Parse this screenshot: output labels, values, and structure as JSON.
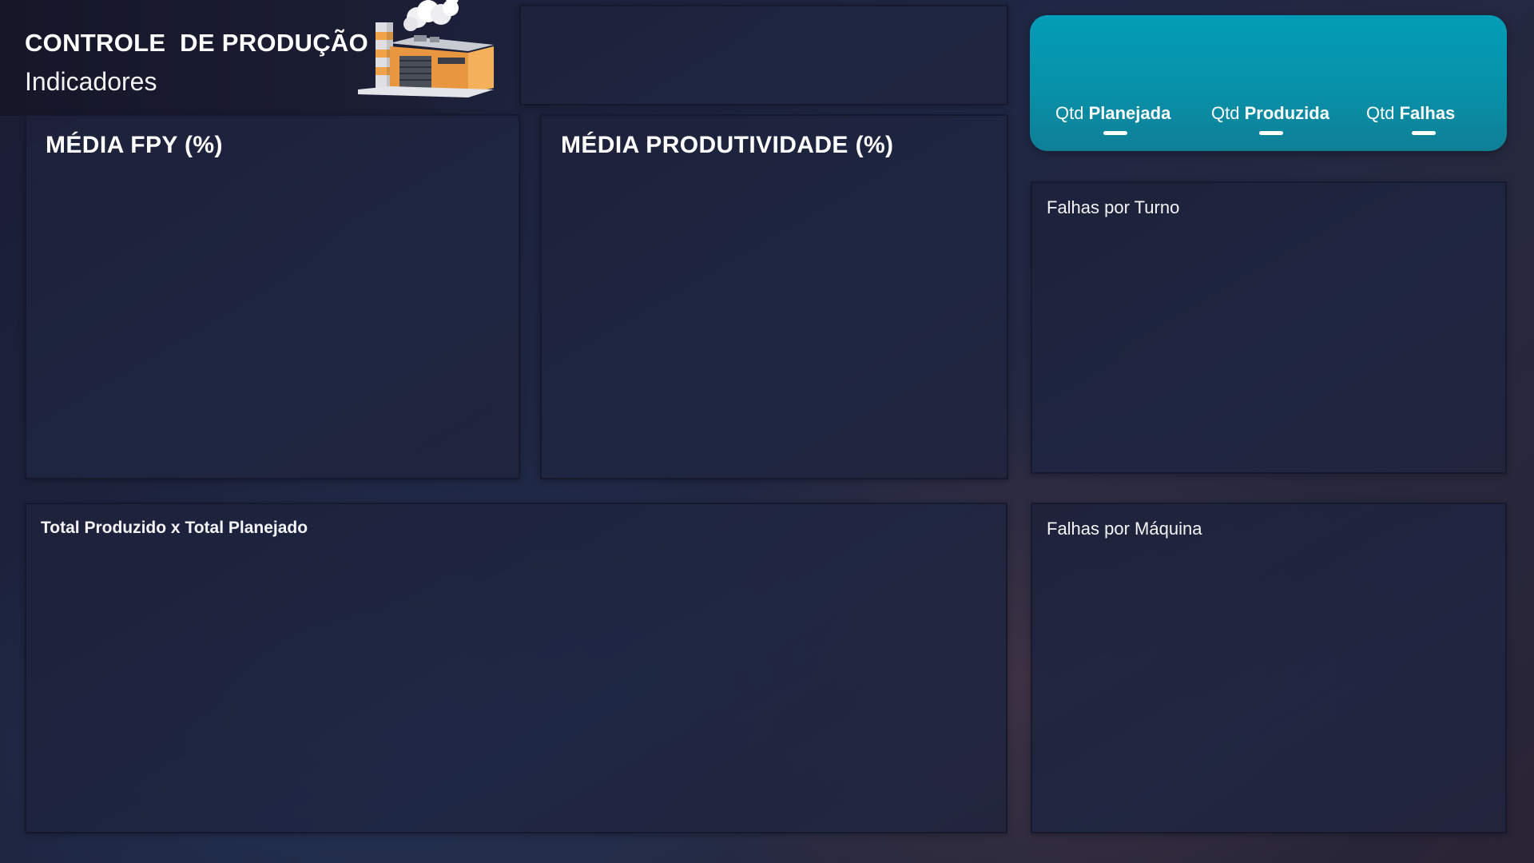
{
  "header": {
    "title": "CONTROLE  DE PRODUÇÃO",
    "subtitle": "Indicadores",
    "logo_icon": "factory-icon"
  },
  "kpis": {
    "fpy_title": "MÉDIA FPY (%)",
    "productivity_title": "MÉDIA PRODUTIVIDADE (%)"
  },
  "tabs": [
    {
      "prefix": "Qtd",
      "label": "Planejada"
    },
    {
      "prefix": "Qtd",
      "label": "Produzida"
    },
    {
      "prefix": "Qtd",
      "label": "Falhas"
    }
  ],
  "charts": {
    "failures_by_shift": "Falhas por Turno",
    "failures_by_machine": "Falhas por Máquina",
    "produced_vs_planned": "Total Produzido x Total Planejado"
  },
  "colors": {
    "accent": "#029db6",
    "background": "#1f2744"
  }
}
